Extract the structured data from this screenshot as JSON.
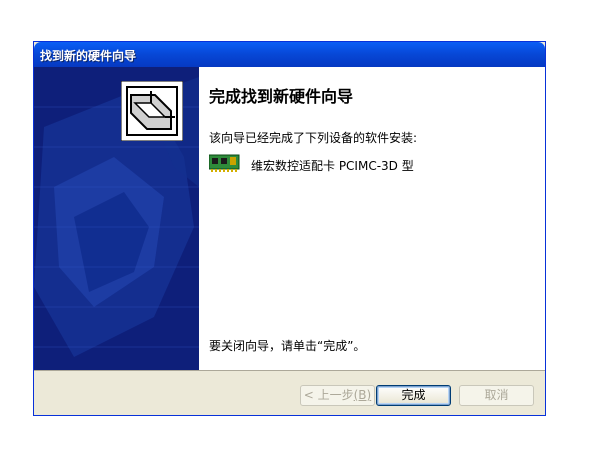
{
  "window": {
    "title": "找到新的硬件向导"
  },
  "content": {
    "heading": "完成找到新硬件向导",
    "description": "该向导已经完成了下列设备的软件安装:",
    "device": {
      "icon": "network-card-icon",
      "name": "维宏数控适配卡 PCIMC-3D 型"
    },
    "close_hint": "要关闭向导，请单击“完成”。"
  },
  "buttons": {
    "back_label": "< 上一步",
    "back_shortcut": "(B)",
    "finish_label": "完成",
    "cancel_label": "取消"
  },
  "colors": {
    "title_bar": "#0a5ef5",
    "side_panel": "#0e1f7a",
    "dialog_face": "#ece9d8"
  }
}
